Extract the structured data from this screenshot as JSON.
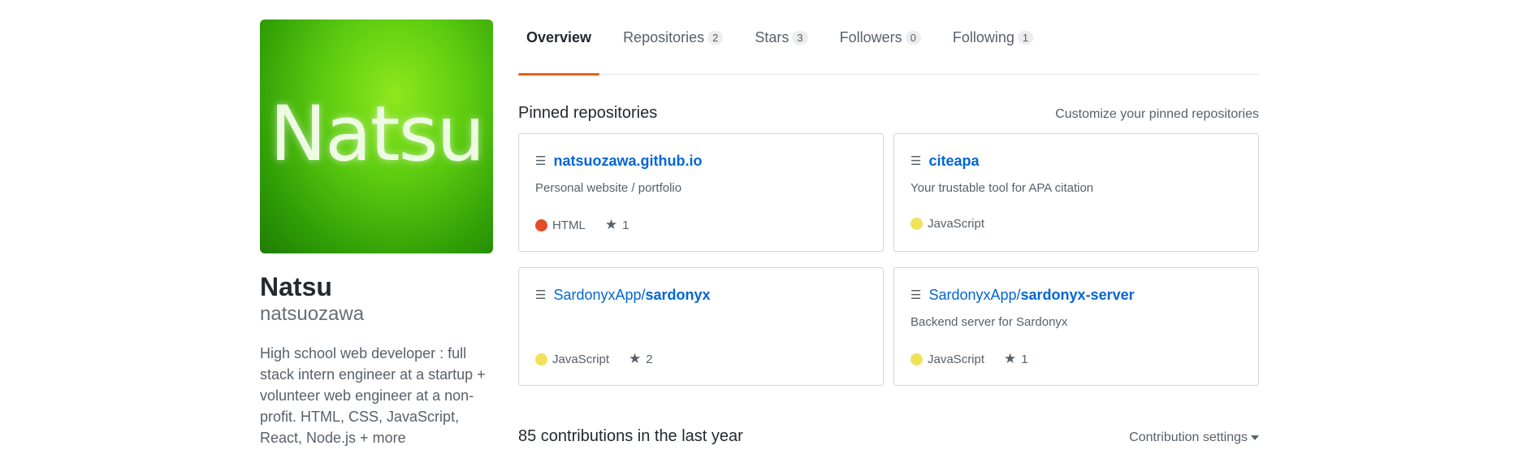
{
  "profile": {
    "avatar_text": "Natsu",
    "fullname": "Natsu",
    "username": "natsuozawa",
    "bio": "High school web developer : full stack intern engineer at a startup + volunteer web engineer at a non-profit. HTML, CSS, JavaScript, React, Node.js + more"
  },
  "tabs": [
    {
      "label": "Overview",
      "count": null,
      "active": true
    },
    {
      "label": "Repositories",
      "count": "2"
    },
    {
      "label": "Stars",
      "count": "3"
    },
    {
      "label": "Followers",
      "count": "0"
    },
    {
      "label": "Following",
      "count": "1"
    }
  ],
  "pinned": {
    "title": "Pinned repositories",
    "customize_label": "Customize your pinned repositories",
    "repos": [
      {
        "owner": "",
        "name": "natsuozawa.github.io",
        "description": "Personal website / portfolio",
        "language": "HTML",
        "language_color": "#e34c26",
        "stars": "1"
      },
      {
        "owner": "",
        "name": "citeapa",
        "description": "Your trustable tool for APA citation",
        "language": "JavaScript",
        "language_color": "#f1e05a",
        "stars": ""
      },
      {
        "owner": "SardonyxApp/",
        "name": "sardonyx",
        "description": "",
        "language": "JavaScript",
        "language_color": "#f1e05a",
        "stars": "2"
      },
      {
        "owner": "SardonyxApp/",
        "name": "sardonyx-server",
        "description": "Backend server for Sardonyx",
        "language": "JavaScript",
        "language_color": "#f1e05a",
        "stars": "1"
      }
    ]
  },
  "contributions": {
    "title": "85 contributions in the last year",
    "settings_label": "Contribution settings"
  },
  "icons": {
    "repo": "repo-icon",
    "star": "star-icon",
    "caret": "caret-down-icon"
  }
}
